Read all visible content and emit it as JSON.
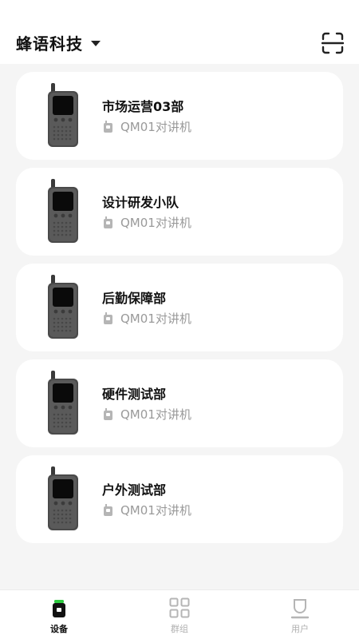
{
  "header": {
    "org_name": "蜂语科技",
    "dropdown_icon": "caret-down-icon",
    "scan_icon": "scan-icon"
  },
  "devices": [
    {
      "name": "市场运营03部",
      "model": "QM01对讲机"
    },
    {
      "name": "设计研发小队",
      "model": "QM01对讲机"
    },
    {
      "name": "后勤保障部",
      "model": "QM01对讲机"
    },
    {
      "name": "硬件测试部",
      "model": "QM01对讲机"
    },
    {
      "name": "户外测试部",
      "model": "QM01对讲机"
    }
  ],
  "tabbar": {
    "tabs": [
      {
        "label": "设备",
        "icon": "device-icon",
        "active": true
      },
      {
        "label": "群组",
        "icon": "grid-icon",
        "active": false
      },
      {
        "label": "用户",
        "icon": "user-icon",
        "active": false
      }
    ]
  },
  "colors": {
    "accent": "#2ecc40",
    "card_bg": "#ffffff",
    "page_bg": "#f5f5f5",
    "muted_text": "#9a9a9a"
  }
}
